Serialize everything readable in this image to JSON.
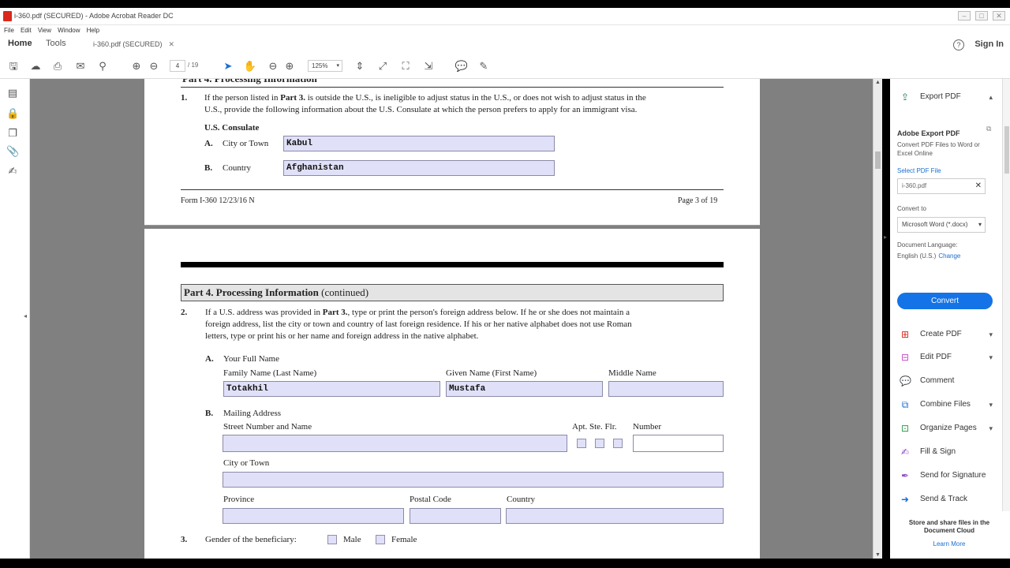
{
  "window": {
    "title": "i-360.pdf (SECURED) - Adobe Acrobat Reader DC"
  },
  "menu": [
    "File",
    "Edit",
    "View",
    "Window",
    "Help"
  ],
  "tabs": {
    "home": "Home",
    "tools": "Tools",
    "document": "i-360.pdf (SECURED)"
  },
  "account": {
    "sign_in": "Sign In"
  },
  "toolbar": {
    "page_current": "4",
    "page_total": "/ 19",
    "zoom": "125%"
  },
  "page1": {
    "section_title": "Part 4.  Processing Information",
    "item1_num": "1.",
    "item1_text_a": "If the person listed in ",
    "item1_part": "Part 3.",
    "item1_text_b": " is outside the U.S., is ineligible to adjust status in the U.S., or does not wish to adjust status in the",
    "item1_line2": "U.S., provide the following information about the U.S. Consulate at which the person prefers to apply for an immigrant visa.",
    "consulate_label": "U.S. Consulate",
    "city_letter": "A.",
    "city_label": "City or Town",
    "city_value": "Kabul",
    "country_letter": "B.",
    "country_label": "Country",
    "country_value": "Afghanistan",
    "footer_left": "Form I-360   12/23/16   N",
    "footer_right": "Page 3 of 19"
  },
  "page2": {
    "section_title": "Part 4.  Processing Information",
    "section_cont": " (continued)",
    "item2_num": "2.",
    "item2_line1a": "If a U.S. address was provided in ",
    "item2_part": "Part 3.",
    "item2_line1b": ", type or print the person's foreign address below.  If he or she does not maintain a",
    "item2_line2": "foreign address, list the city or town and country of last foreign residence.  If his or her native alphabet does not use Roman",
    "item2_line3": "letters, type or print his or her name and foreign address in the native alphabet.",
    "name_letter": "A.",
    "name_heading": "Your Full Name",
    "family_label": "Family Name (Last Name)",
    "family_value": "Totakhil",
    "given_label": "Given Name (First Name)",
    "given_value": "Mustafa",
    "middle_label": "Middle Name",
    "middle_value": "",
    "addr_letter": "B.",
    "addr_heading": "Mailing Address",
    "street_label": "Street Number and Name",
    "apt_label": "Apt. Ste. Flr.",
    "number_label": "Number",
    "city_label": "City or Town",
    "province_label": "Province",
    "postal_label": "Postal Code",
    "country_label": "Country",
    "item3_num": "3.",
    "gender_label": "Gender of the beneficiary:",
    "male_label": "Male",
    "female_label": "Female"
  },
  "right_panel": {
    "export_pdf": "Export PDF",
    "adobe_export_title": "Adobe Export PDF",
    "adobe_export_desc": "Convert PDF Files to Word or Excel Online",
    "select_file": "Select PDF File",
    "file_name": "i-360.pdf",
    "convert_to_label": "Convert to",
    "convert_to_value": "Microsoft Word (*.docx)",
    "doc_lang_label": "Document Language:",
    "doc_lang_value": "English (U.S.)",
    "change": "Change",
    "convert_button": "Convert",
    "tools": [
      {
        "label": "Create PDF",
        "icon": "create-pdf-icon",
        "chevron": true
      },
      {
        "label": "Edit PDF",
        "icon": "edit-pdf-icon",
        "chevron": true
      },
      {
        "label": "Comment",
        "icon": "comment-icon",
        "chevron": false
      },
      {
        "label": "Combine Files",
        "icon": "combine-files-icon",
        "chevron": true
      },
      {
        "label": "Organize Pages",
        "icon": "organize-pages-icon",
        "chevron": true
      },
      {
        "label": "Fill & Sign",
        "icon": "fill-sign-icon",
        "chevron": false
      },
      {
        "label": "Send for Signature",
        "icon": "send-signature-icon",
        "chevron": false
      },
      {
        "label": "Send & Track",
        "icon": "send-track-icon",
        "chevron": false
      }
    ],
    "cloud_note": "Store and share files in the Document Cloud",
    "learn_more": "Learn More"
  },
  "colors": {
    "accent": "#1473e6",
    "field_fill": "#e0e0f8",
    "pdf_red": "#d9291c"
  }
}
